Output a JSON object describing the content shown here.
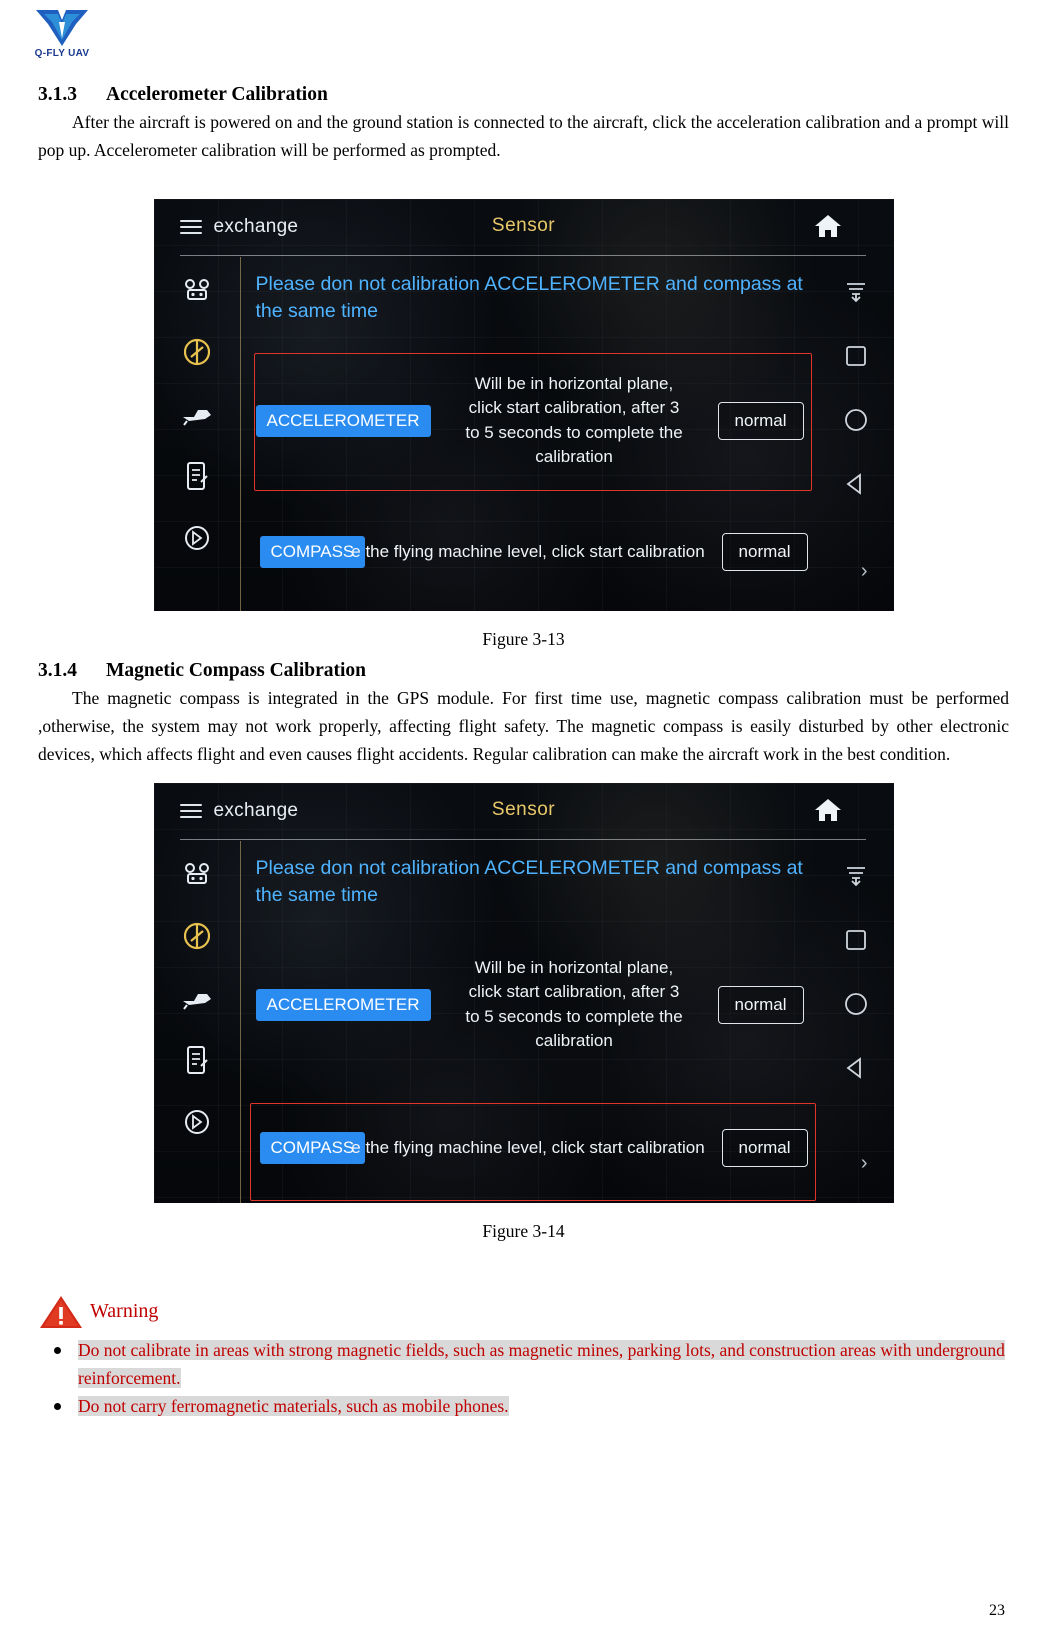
{
  "logo": {
    "text": "Q-FLY UAV",
    "icon": "drone-logo-icon"
  },
  "sections": [
    {
      "number": "3.1.3",
      "title": "Accelerometer Calibration",
      "paragraph": "After the aircraft is powered on and the ground station is connected to the aircraft, click the acceleration calibration and a prompt will pop up. Accelerometer calibration will be performed as prompted.",
      "figure_caption": "Figure 3-13"
    },
    {
      "number": "3.1.4",
      "title": "Magnetic Compass Calibration",
      "paragraph": "The magnetic compass is integrated in the GPS module. For first time use, magnetic compass calibration must be performed ,otherwise, the system may not work properly, affecting flight safety. The magnetic compass is easily disturbed by other electronic devices, which affects flight and even causes flight accidents. Regular calibration can make the aircraft work in the best condition.",
      "figure_caption": "Figure 3-14"
    }
  ],
  "app": {
    "menu_label": "exchange",
    "title": "Sensor",
    "home_icon": "home-icon",
    "menu_icon": "hamburger-icon",
    "left_rail": [
      "aircraft-icon",
      "compass-icon",
      "gimbal-icon",
      "checklist-icon",
      "battery-icon"
    ],
    "right_rail": [
      "download-icon",
      "square-icon",
      "circle-icon",
      "back-triangle-icon"
    ],
    "chevron_icon": "chevron-right-icon",
    "notice": "Please don not calibration ACCELEROMETER and compass at the same time",
    "accelerometer": {
      "button_label": "ACCELEROMETER",
      "instruction": "Will be in horizontal plane,\nclick start calibration, after 3\nto 5 seconds to complete the\ncalibration",
      "status": "normal"
    },
    "compass": {
      "button_label": "COMPASS",
      "instruction": "e the flying machine level, click start calibration",
      "status": "normal"
    },
    "accent_colors": {
      "title": "#e8c86a",
      "notice": "#4fb3ff",
      "pill": "#2a8cf0",
      "highlight_box": "#e1352a"
    }
  },
  "warning": {
    "title": "Warning",
    "icon": "warning-triangle-icon",
    "items": [
      "Do not calibrate in areas with strong magnetic fields, such as magnetic mines, parking lots, and construction areas with underground reinforcement.",
      "Do not carry ferromagnetic materials, such as mobile phones."
    ]
  },
  "page_number": "23"
}
